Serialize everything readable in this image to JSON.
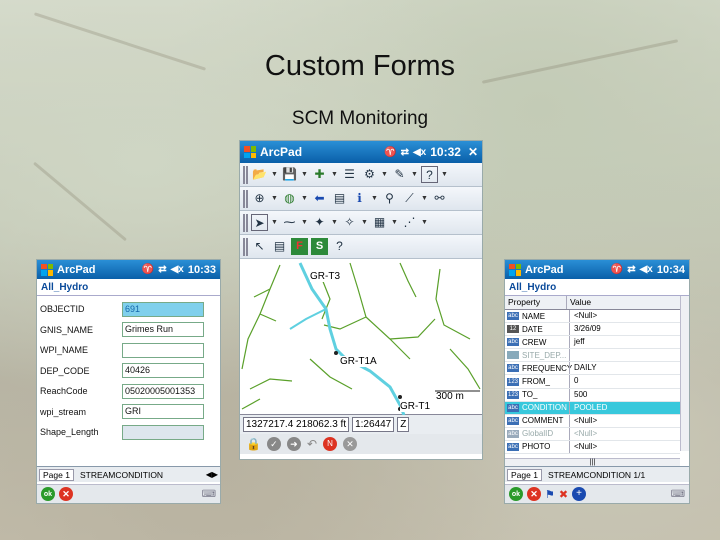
{
  "slide": {
    "title": "Custom Forms",
    "subtitle": "SCM Monitoring"
  },
  "left_phone": {
    "app_title": "ArcPad",
    "time": "10:33",
    "layer": "All_Hydro",
    "fields": [
      {
        "label": "OBJECTID",
        "value": "691"
      },
      {
        "label": "GNIS_NAME",
        "value": "Grimes Run"
      },
      {
        "label": "WPI_NAME",
        "value": ""
      },
      {
        "label": "DEP_CODE",
        "value": "40426"
      },
      {
        "label": "ReachCode",
        "value": "05020005001353"
      },
      {
        "label": "wpi_stream",
        "value": "GRI"
      },
      {
        "label": "Shape_Length",
        "value": ""
      }
    ],
    "tabs": [
      "Page 1",
      "STREAMCONDITION"
    ],
    "ok_label": "ok"
  },
  "center_phone": {
    "app_title": "ArcPad",
    "time": "10:32",
    "map_labels": [
      "GR-T3",
      "GR-T1A",
      "GR-T1"
    ],
    "scale_bar": "300 m",
    "coords": "1327217.4 218062.3 ft",
    "scale": "1:26447",
    "z_label": "Z",
    "tool_f": "F",
    "tool_s": "S",
    "colors": {
      "stream_highlight": "#5fd0e0",
      "streams": "#5aa02a"
    }
  },
  "right_phone": {
    "app_title": "ArcPad",
    "time": "10:34",
    "layer": "All_Hydro",
    "columns": [
      "Property",
      "Value"
    ],
    "rows": [
      {
        "type": "abc",
        "property": "NAME",
        "value": "<Null>"
      },
      {
        "type": "12",
        "property": "DATE",
        "value": "3/26/09"
      },
      {
        "type": "abc",
        "property": "CREW",
        "value": "jeff"
      },
      {
        "type": "",
        "property": "SITE_DEP...",
        "value": ""
      },
      {
        "type": "abc",
        "property": "FREQUENCY",
        "value": "DAILY"
      },
      {
        "type": "123",
        "property": "FROM_",
        "value": "0"
      },
      {
        "type": "123",
        "property": "TO_",
        "value": "500"
      },
      {
        "type": "abc",
        "property": "CONDITION",
        "value": "POOLED"
      },
      {
        "type": "abc",
        "property": "COMMENT",
        "value": "<Null>"
      },
      {
        "type": "abc",
        "property": "GlobalID",
        "value": "<Null>"
      },
      {
        "type": "abc",
        "property": "PHOTO",
        "value": "<Null>"
      }
    ],
    "tabs": [
      "Page 1",
      "STREAMCONDITION 1/1"
    ],
    "ok_label": "ok"
  }
}
